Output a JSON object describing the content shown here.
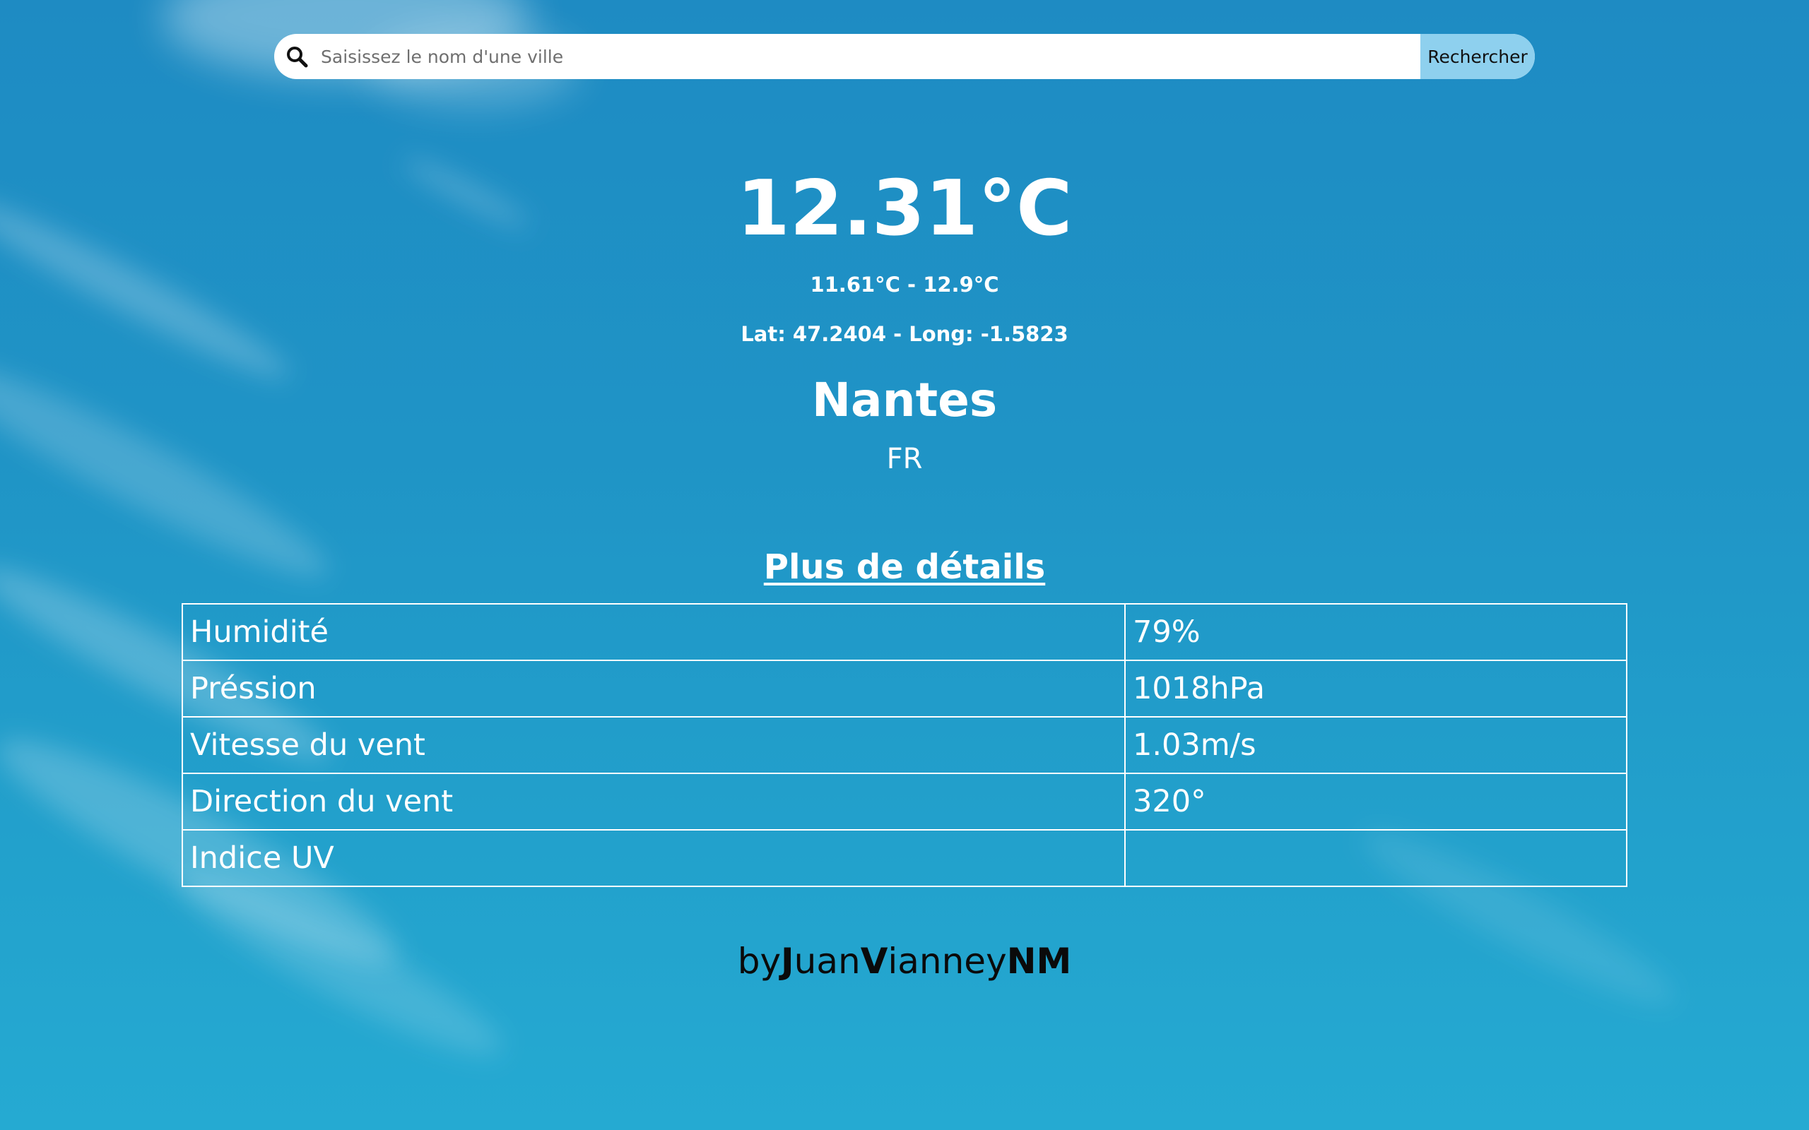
{
  "search": {
    "placeholder": "Saisissez le nom d'une ville",
    "button_label": "Rechercher",
    "icon": "magnifier"
  },
  "weather": {
    "temperature": "12.31°C",
    "range": "11.61°C - 12.9°C",
    "coordinates": "Lat: 47.2404 - Long: -1.5823",
    "city": "Nantes",
    "country": "FR"
  },
  "details": {
    "title": "Plus de détails",
    "rows": [
      {
        "label": "Humidité",
        "value": "79%"
      },
      {
        "label": "Préssion",
        "value": "1018hPa"
      },
      {
        "label": "Vitesse du vent",
        "value": "1.03m/s"
      },
      {
        "label": "Direction du vent",
        "value": "320°"
      },
      {
        "label": "Indice UV",
        "value": ""
      }
    ]
  },
  "footer": {
    "p1": "by",
    "p2": "J",
    "p3": "uan",
    "p4": "V",
    "p5": "ianney",
    "p6": "NM"
  },
  "colors": {
    "background": "#1f94c6",
    "button": "#8ed0ee",
    "text": "#ffffff"
  }
}
